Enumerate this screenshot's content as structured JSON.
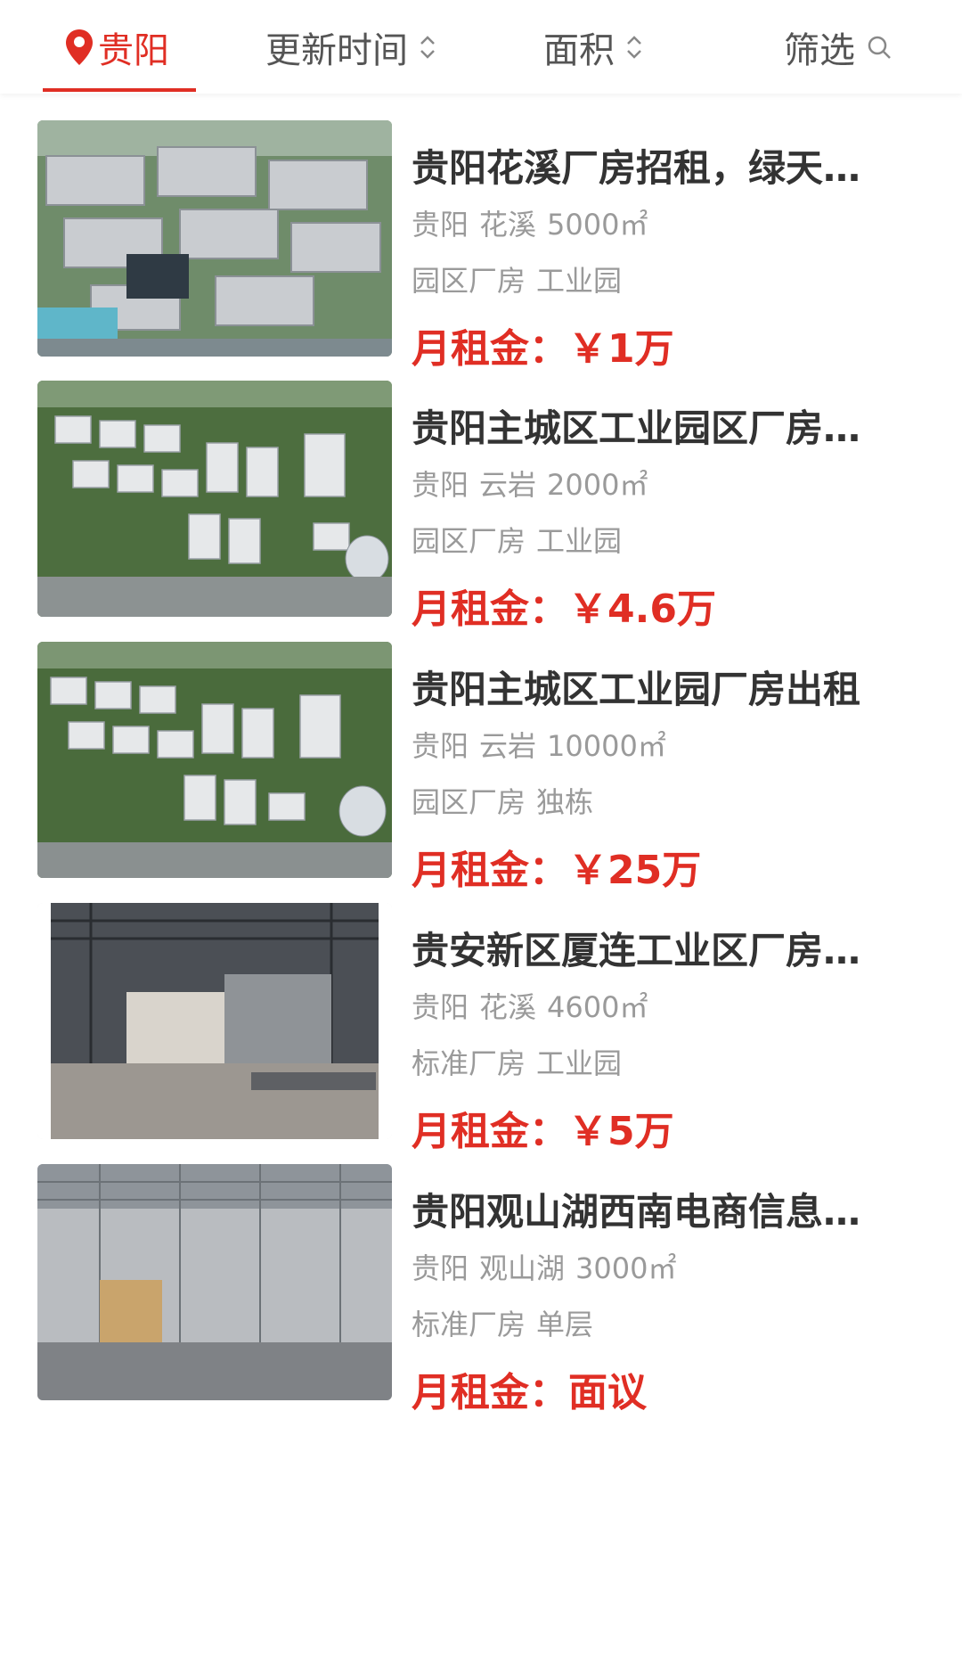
{
  "filter_bar": {
    "city": "贵阳",
    "sort_update": "更新时间",
    "sort_area": "面积",
    "filter": "筛选",
    "icons": {
      "city": "location-pin-icon",
      "sort": "sort-arrows-icon",
      "filter": "search-icon"
    },
    "accent_color": "#e02e24"
  },
  "listings": [
    {
      "title": "贵阳花溪厂房招租，绿天…",
      "city": "贵阳",
      "district": "花溪",
      "area": "5000㎡",
      "tag1": "园区厂房",
      "tag2": "工业园",
      "price_label": "月租金：",
      "price": "￥1万",
      "image": "aerial-industrial-park"
    },
    {
      "title": "贵阳主城区工业园区厂房…",
      "city": "贵阳",
      "district": "云岩",
      "area": "2000㎡",
      "tag1": "园区厂房",
      "tag2": "工业园",
      "price_label": "月租金：",
      "price": "￥4.6万",
      "image": "aerial-park-rendering"
    },
    {
      "title": "贵阳主城区工业园厂房出租",
      "city": "贵阳",
      "district": "云岩",
      "area": "10000㎡",
      "tag1": "园区厂房",
      "tag2": "独栋",
      "price_label": "月租金：",
      "price": "￥25万",
      "image": "aerial-park-rendering"
    },
    {
      "title": "贵安新区厦连工业区厂房…",
      "city": "贵阳",
      "district": "花溪",
      "area": "4600㎡",
      "tag1": "标准厂房",
      "tag2": "工业园",
      "price_label": "月租金：",
      "price": "￥5万",
      "image": "warehouse-interior"
    },
    {
      "title": "贵阳观山湖西南电商信息…",
      "city": "贵阳",
      "district": "观山湖",
      "area": "3000㎡",
      "tag1": "标准厂房",
      "tag2": "单层",
      "price_label": "月租金：",
      "price": "面议",
      "image": "warehouse-interior-empty"
    }
  ]
}
